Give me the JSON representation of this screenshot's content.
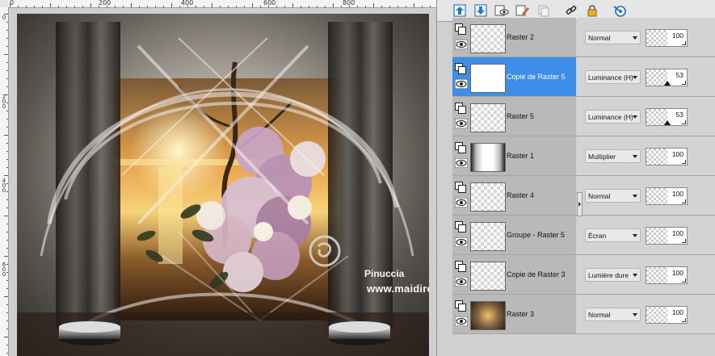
{
  "rulers": {
    "top_labels": [
      "0",
      "200",
      "400",
      "600",
      "800"
    ],
    "left_labels": [
      "0",
      "200",
      "400",
      "600"
    ]
  },
  "watermark": {
    "name": "Pinuccia",
    "url": "www.maidiregrafica.eu"
  },
  "toolbar": {
    "icons": [
      "layer-up-icon",
      "layer-down-icon",
      "visibility-toggle-icon",
      "edit-icon",
      "duplicate-icon",
      "link-icon",
      "lock-icon",
      "properties-icon"
    ]
  },
  "layers": [
    {
      "name": "Raster 2",
      "blend": "Normal",
      "opacity": "100",
      "selected": false,
      "slider": false
    },
    {
      "name": "Copie de Raster 5",
      "blend": "Luminance (H)",
      "opacity": "53",
      "selected": true,
      "slider": true
    },
    {
      "name": "Raster 5",
      "blend": "Luminance (H)",
      "opacity": "53",
      "selected": false,
      "slider": true
    },
    {
      "name": "Raster 1",
      "blend": "Multiplier",
      "opacity": "100",
      "selected": false,
      "slider": false
    },
    {
      "name": "Raster 4",
      "blend": "Normal",
      "opacity": "100",
      "selected": false,
      "slider": false
    },
    {
      "name": "Groupe - Raster 5",
      "blend": "Écran",
      "opacity": "100",
      "selected": false,
      "slider": false
    },
    {
      "name": "Copie de Raster 3",
      "blend": "Lumière dure",
      "opacity": "100",
      "selected": false,
      "slider": false
    },
    {
      "name": "Raster 3",
      "blend": "Normal",
      "opacity": "100",
      "selected": false,
      "slider": false
    }
  ],
  "colors": {
    "selected_row": "#3d8ee8",
    "panel_bg": "#d0d0d0"
  }
}
